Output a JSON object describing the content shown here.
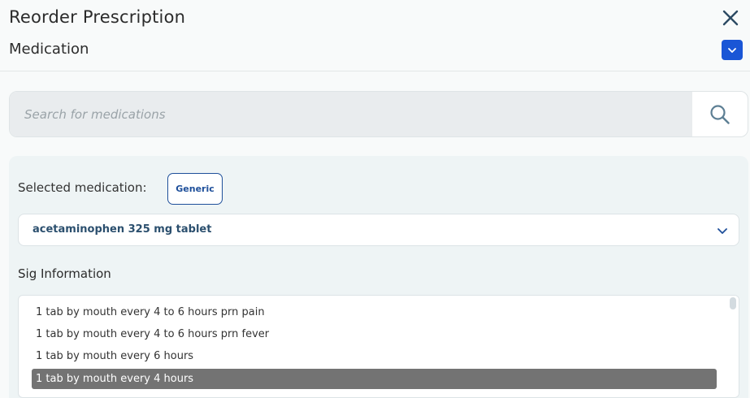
{
  "header": {
    "title": "Reorder Prescription",
    "close_icon": "close-icon",
    "section_title": "Medication",
    "collapse_icon": "chevron-down-icon"
  },
  "search": {
    "placeholder": "Search for medications",
    "value": "",
    "icon": "search-icon"
  },
  "selection": {
    "label": "Selected medication:",
    "badge": "Generic",
    "medication": "acetaminophen 325 mg tablet"
  },
  "sig": {
    "title": "Sig Information",
    "items": [
      "1 tab by mouth every 4 to 6 hours prn pain",
      "1 tab by mouth every 4 to 6 hours prn fever",
      "1 tab by mouth every 6 hours",
      "1 tab by mouth every 4 hours"
    ],
    "selected_index": 3
  },
  "colors": {
    "accent": "#1a56d6",
    "link": "#1e4f9a",
    "selected_row": "#737373"
  }
}
